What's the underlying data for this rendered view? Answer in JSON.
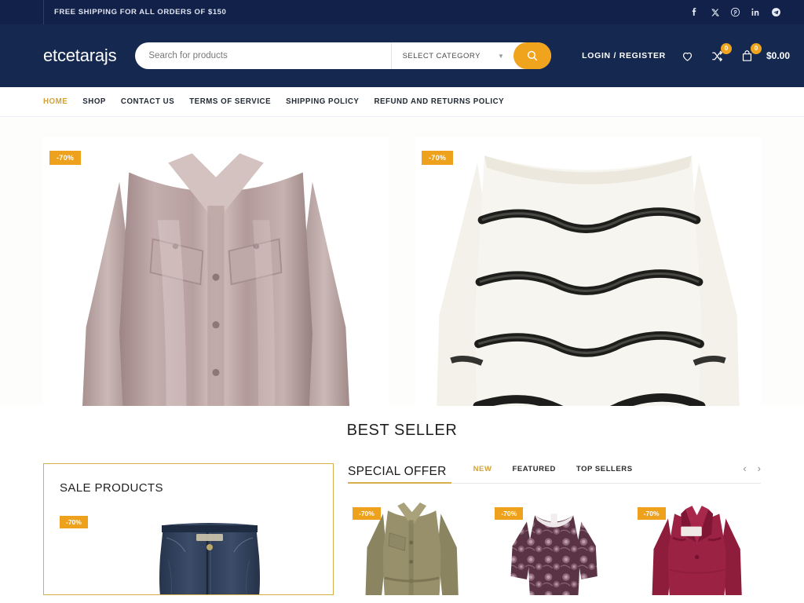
{
  "topbar": {
    "message": "FREE SHIPPING FOR ALL ORDERS OF $150",
    "socials": [
      {
        "name": "facebook-icon",
        "label": "f"
      },
      {
        "name": "x-twitter-icon",
        "label": "X"
      },
      {
        "name": "pinterest-icon",
        "label": "P"
      },
      {
        "name": "linkedin-icon",
        "label": "in"
      },
      {
        "name": "telegram-icon",
        "label": "T"
      }
    ]
  },
  "header": {
    "logo": "etcetarajs",
    "search": {
      "placeholder": "Search for products",
      "value": "",
      "category_label": "SELECT CATEGORY"
    },
    "account_label": "LOGIN / REGISTER",
    "wishlist_count": "",
    "compare_count": "0",
    "cart_count": "0",
    "cart_total": "$0.00"
  },
  "nav": {
    "items": [
      {
        "label": "HOME",
        "active": true
      },
      {
        "label": "SHOP",
        "active": false
      },
      {
        "label": "CONTACT US",
        "active": false
      },
      {
        "label": "TERMS OF SERVICE",
        "active": false
      },
      {
        "label": "SHIPPING POLICY",
        "active": false
      },
      {
        "label": "REFUND AND RETURNS POLICY",
        "active": false
      }
    ]
  },
  "hero": {
    "cards": [
      {
        "badge": "-70%",
        "product": "satin-blouse"
      },
      {
        "badge": "-70%",
        "product": "striped-sweater"
      }
    ]
  },
  "best_seller": {
    "title": "BEST SELLER"
  },
  "sale_products": {
    "title": "SALE PRODUCTS",
    "badge": "-70%",
    "product": "denim-jeans"
  },
  "special_offer": {
    "title": "SPECIAL OFFER",
    "tabs": [
      {
        "label": "NEW",
        "active": true
      },
      {
        "label": "FEATURED",
        "active": false
      },
      {
        "label": "TOP SELLERS",
        "active": false
      }
    ],
    "prev_arrow": "‹",
    "next_arrow": "›",
    "products": [
      {
        "badge": "-70%",
        "product": "khaki-jacket"
      },
      {
        "badge": "-70%",
        "product": "floral-top"
      },
      {
        "badge": "-70%",
        "product": "burgundy-blazer"
      }
    ]
  },
  "colors": {
    "navy_dark": "#11214a",
    "navy": "#15284f",
    "accent_orange": "#eda11c",
    "accent_gold": "#d1a23c"
  }
}
